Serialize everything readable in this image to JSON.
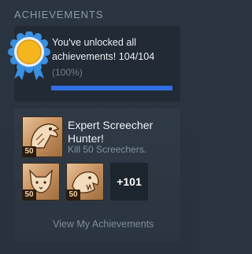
{
  "section": {
    "title": "ACHIEVEMENTS"
  },
  "summary": {
    "message": "You've unlocked all achievements! 104/104",
    "percent_text": "(100%)",
    "progress_fraction": 1.0,
    "medal_icon": "gold-medal-ribbon-icon"
  },
  "featured": {
    "name": "Expert Screecher Hunter!",
    "description": "Kill 50 Screechers.",
    "icon": "bird-head-achievement-icon",
    "badge": "50"
  },
  "thumbnails": [
    {
      "icon": "fox-achievement-icon",
      "badge": "50"
    },
    {
      "icon": "beast-achievement-icon",
      "badge": "50"
    }
  ],
  "more_count": "+101",
  "view_link": "View My Achievements",
  "colors": {
    "background": "#2a3340",
    "progress": "#2f6fe3",
    "medal_gold": "#f5b51e",
    "medal_ribbon": "#3b8fe0"
  }
}
